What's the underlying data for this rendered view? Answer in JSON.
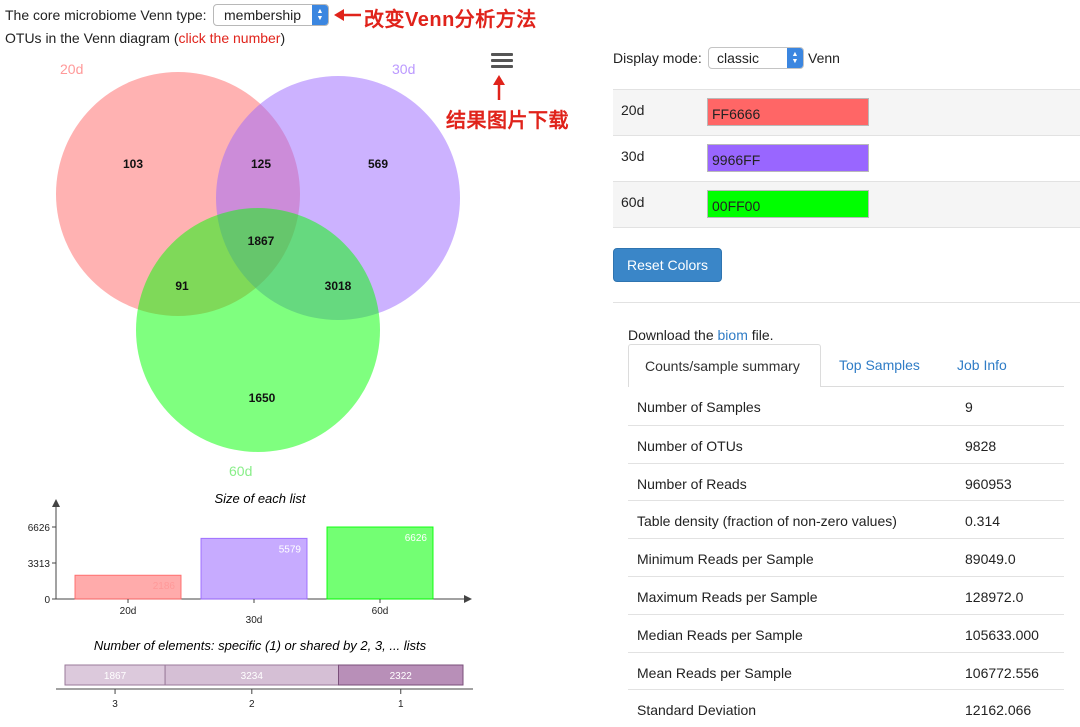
{
  "venn_type": {
    "label": "The core microbiome Venn type:",
    "selected": "membership",
    "annotation": "改变Venn分析方法"
  },
  "otu_line": {
    "text": "OTUs in the Venn diagram (",
    "link": "click the number",
    "close": ")"
  },
  "venn": {
    "sets": [
      {
        "name": "20d",
        "color": "#FF6666"
      },
      {
        "name": "30d",
        "color": "#9966FF"
      },
      {
        "name": "60d",
        "color": "#00FF00"
      }
    ],
    "regions": {
      "only_20d": "103",
      "only_30d": "569",
      "only_60d": "1650",
      "20d_30d": "125",
      "20d_60d": "91",
      "30d_60d": "3018",
      "all": "1867"
    },
    "download_annotation": "结果图片下载",
    "menu_icon": "hamburger-icon"
  },
  "chart_data": [
    {
      "type": "bar",
      "title": "Size of each list",
      "categories": [
        "20d",
        "30d",
        "60d"
      ],
      "values": [
        2186,
        5579,
        6626
      ],
      "colors": [
        "#FF6666",
        "#9966FF",
        "#00FF00"
      ],
      "yticks": [
        "6626",
        "3313",
        "0"
      ],
      "ylim": [
        0,
        6626
      ]
    },
    {
      "type": "bar",
      "title": "Number of elements: specific (1) or shared by 2, 3, ... lists",
      "categories": [
        "3",
        "2",
        "1"
      ],
      "values": [
        1867,
        3234,
        2322
      ]
    }
  ],
  "display_mode": {
    "label": "Display mode:",
    "selected": "classic",
    "suffix": "Venn"
  },
  "color_table": [
    {
      "name": "20d",
      "hex": "FF6666",
      "color": "#FF6666"
    },
    {
      "name": "30d",
      "hex": "9966FF",
      "color": "#9966FF"
    },
    {
      "name": "60d",
      "hex": "00FF00",
      "color": "#00FF00"
    }
  ],
  "reset_label": "Reset Colors",
  "download": {
    "prefix": "Download the ",
    "link": "biom",
    "suffix": " file."
  },
  "tabs": [
    {
      "label": "Counts/sample summary"
    },
    {
      "label": "Top Samples"
    },
    {
      "label": "Job Info"
    }
  ],
  "summary": [
    {
      "key": "Number of Samples",
      "value": "9"
    },
    {
      "key": "Number of OTUs",
      "value": "9828"
    },
    {
      "key": "Number of Reads",
      "value": "960953"
    },
    {
      "key": "Table density (fraction of non-zero values)",
      "value": "0.314"
    },
    {
      "key": "Minimum Reads per Sample",
      "value": "89049.0"
    },
    {
      "key": "Maximum Reads per Sample",
      "value": "128972.0"
    },
    {
      "key": "Median Reads per Sample",
      "value": "105633.000"
    },
    {
      "key": "Mean Reads per Sample",
      "value": "106772.556"
    },
    {
      "key": "Standard Deviation",
      "value": "12162.066"
    }
  ]
}
